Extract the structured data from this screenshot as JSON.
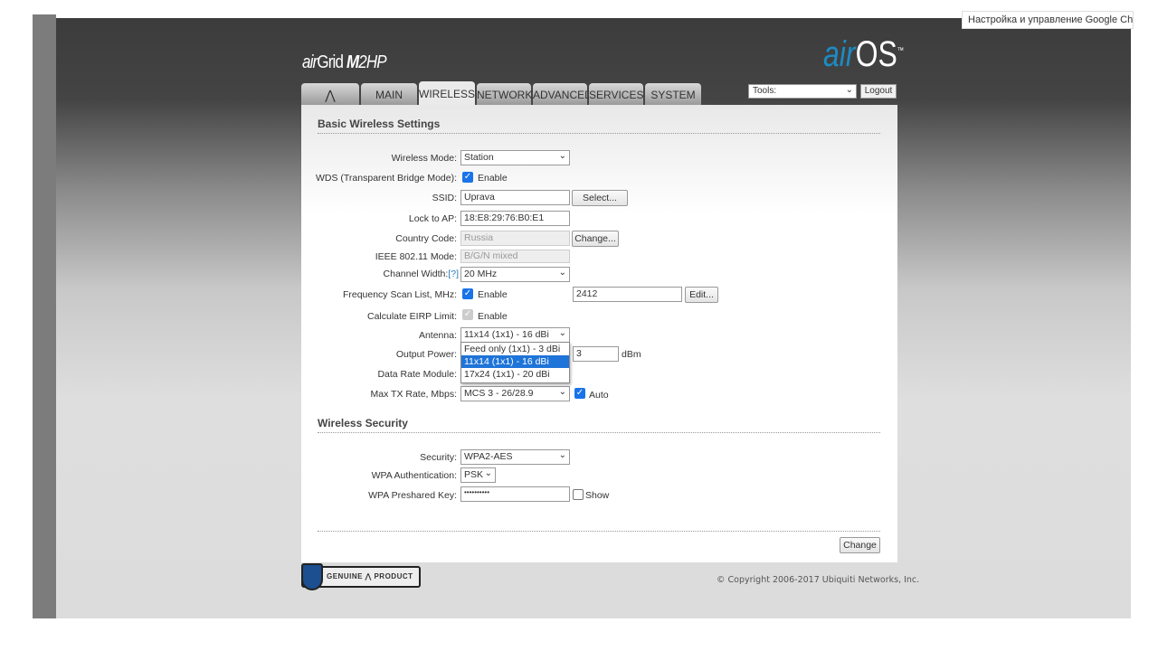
{
  "browser_tooltip": "Настройка и управление Google Chrome",
  "header": {
    "product": "air",
    "product2": "Grid ",
    "model_m": "M",
    "model": "2HP",
    "brand_a": "air",
    "brand_b": "OS",
    "brand_tm": "™"
  },
  "tabs": [
    {
      "label": ""
    },
    {
      "label": "MAIN"
    },
    {
      "label": "WIRELESS"
    },
    {
      "label": "NETWORK"
    },
    {
      "label": "ADVANCED"
    },
    {
      "label": "SERVICES"
    },
    {
      "label": "SYSTEM"
    }
  ],
  "tools": {
    "label": "Tools:",
    "logout": "Logout"
  },
  "basic": {
    "title": "Basic Wireless Settings",
    "wireless_mode": {
      "label": "Wireless Mode:",
      "value": "Station"
    },
    "wds": {
      "label": "WDS (Transparent Bridge Mode):",
      "checkbox": "Enable"
    },
    "ssid": {
      "label": "SSID:",
      "value": "Uprava",
      "button": "Select..."
    },
    "lock_ap": {
      "label": "Lock to AP:",
      "value": "18:E8:29:76:B0:E1"
    },
    "country": {
      "label": "Country Code:",
      "value": "Russia",
      "button": "Change..."
    },
    "ieee": {
      "label": "IEEE 802.11 Mode:",
      "value": "B/G/N mixed"
    },
    "channel_width": {
      "label": "Channel Width:",
      "help": "[?]",
      "value": "20 MHz"
    },
    "freq_scan": {
      "label": "Frequency Scan List, MHz:",
      "checkbox": "Enable",
      "value": "2412",
      "button": "Edit..."
    },
    "eirp": {
      "label": "Calculate EIRP Limit:",
      "checkbox": "Enable"
    },
    "antenna": {
      "label": "Antenna:",
      "value": "11x14 (1x1) - 16 dBi",
      "options": [
        "Feed only (1x1) - 3 dBi",
        "11x14 (1x1) - 16 dBi",
        "17x24 (1x1) - 20 dBi"
      ]
    },
    "output_power": {
      "label": "Output Power:",
      "value": "3",
      "unit": "dBm"
    },
    "data_rate": {
      "label": "Data Rate Module:"
    },
    "max_tx": {
      "label": "Max TX Rate, Mbps:",
      "value": "MCS 3 - 26/28.9",
      "checkbox": "Auto"
    }
  },
  "security": {
    "title": "Wireless Security",
    "security": {
      "label": "Security:",
      "value": "WPA2-AES"
    },
    "wpa_auth": {
      "label": "WPA Authentication:",
      "value": "PSK"
    },
    "psk": {
      "label": "WPA Preshared Key:",
      "value": "••••••••••",
      "checkbox": "Show"
    }
  },
  "change_button": "Change",
  "footer": {
    "genuine": "GENUINE ⋀ PRODUCT",
    "copyright": "© Copyright 2006-2017 Ubiquiti Networks, Inc."
  }
}
